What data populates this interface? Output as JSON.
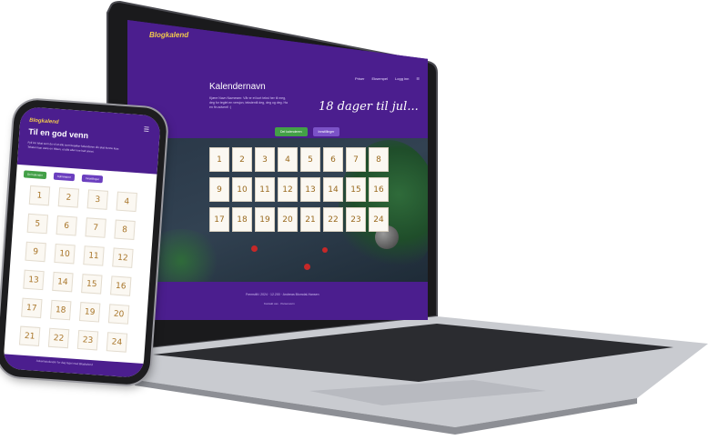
{
  "laptop": {
    "logo": "Blogkalend",
    "nav": [
      "Priser",
      "Eksempel",
      "Logg inn",
      "☰"
    ],
    "title": "Kalendernavn",
    "description": "Kjære Navn Navnesen: Vår er et kort tekst her til meg, deg for teglet en versjon, tekstentil deg, deg og deg. Ha en fin advent! :)",
    "countdown": "18 dager til jul...",
    "buttons": [
      "Del kalenderen",
      "Innstillinger"
    ],
    "doors": [
      "1",
      "2",
      "3",
      "4",
      "5",
      "6",
      "7",
      "8",
      "9",
      "10",
      "11",
      "12",
      "13",
      "14",
      "15",
      "16",
      "17",
      "18",
      "19",
      "20",
      "21",
      "22",
      "23",
      "24"
    ],
    "footer": "Fremstilt i 2024 · 12.200 · Andreas Blomdal-Hansen",
    "footer_sub": "Kontakt oss · Personvern"
  },
  "phone": {
    "logo": "Blogkalend",
    "menu": "☰",
    "title": "Til en god venn",
    "description": "Fyll inn tekst som du vil at alle som besøker kalenderen din skal kunne lese. Teksten kan være en hilsen, et dikt eller noe helt annet.",
    "buttons": [
      "Del kalender",
      "Administrer",
      "Innstillinger"
    ],
    "doors": [
      "1",
      "2",
      "3",
      "4",
      "5",
      "6",
      "7",
      "8",
      "9",
      "10",
      "11",
      "12",
      "13",
      "14",
      "15",
      "16",
      "17",
      "18",
      "19",
      "20",
      "21",
      "22",
      "23",
      "24"
    ],
    "footer": "Adventskalender for deg laget med Blogkalend"
  },
  "colors": {
    "brand_purple": "#4b1e8e",
    "accent_gold": "#f2c94c",
    "button_green": "#43a047",
    "door_number": "#a9762a"
  }
}
